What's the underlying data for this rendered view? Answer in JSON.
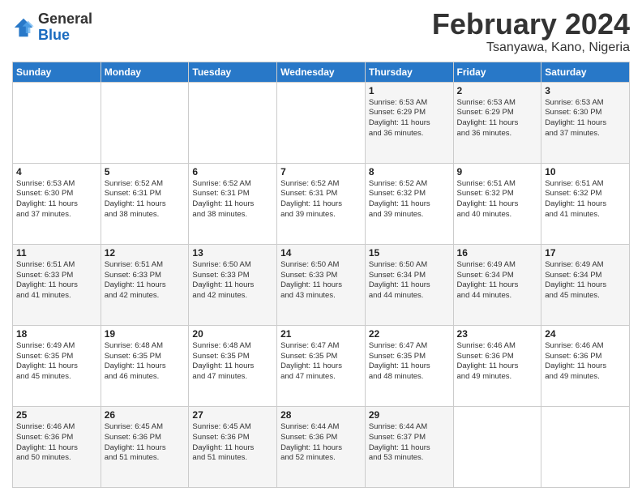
{
  "header": {
    "logo_line1": "General",
    "logo_line2": "Blue",
    "month": "February 2024",
    "location": "Tsanyawa, Kano, Nigeria"
  },
  "weekdays": [
    "Sunday",
    "Monday",
    "Tuesday",
    "Wednesday",
    "Thursday",
    "Friday",
    "Saturday"
  ],
  "weeks": [
    [
      {
        "day": "",
        "info": ""
      },
      {
        "day": "",
        "info": ""
      },
      {
        "day": "",
        "info": ""
      },
      {
        "day": "",
        "info": ""
      },
      {
        "day": "1",
        "info": "Sunrise: 6:53 AM\nSunset: 6:29 PM\nDaylight: 11 hours\nand 36 minutes."
      },
      {
        "day": "2",
        "info": "Sunrise: 6:53 AM\nSunset: 6:29 PM\nDaylight: 11 hours\nand 36 minutes."
      },
      {
        "day": "3",
        "info": "Sunrise: 6:53 AM\nSunset: 6:30 PM\nDaylight: 11 hours\nand 37 minutes."
      }
    ],
    [
      {
        "day": "4",
        "info": "Sunrise: 6:53 AM\nSunset: 6:30 PM\nDaylight: 11 hours\nand 37 minutes."
      },
      {
        "day": "5",
        "info": "Sunrise: 6:52 AM\nSunset: 6:31 PM\nDaylight: 11 hours\nand 38 minutes."
      },
      {
        "day": "6",
        "info": "Sunrise: 6:52 AM\nSunset: 6:31 PM\nDaylight: 11 hours\nand 38 minutes."
      },
      {
        "day": "7",
        "info": "Sunrise: 6:52 AM\nSunset: 6:31 PM\nDaylight: 11 hours\nand 39 minutes."
      },
      {
        "day": "8",
        "info": "Sunrise: 6:52 AM\nSunset: 6:32 PM\nDaylight: 11 hours\nand 39 minutes."
      },
      {
        "day": "9",
        "info": "Sunrise: 6:51 AM\nSunset: 6:32 PM\nDaylight: 11 hours\nand 40 minutes."
      },
      {
        "day": "10",
        "info": "Sunrise: 6:51 AM\nSunset: 6:32 PM\nDaylight: 11 hours\nand 41 minutes."
      }
    ],
    [
      {
        "day": "11",
        "info": "Sunrise: 6:51 AM\nSunset: 6:33 PM\nDaylight: 11 hours\nand 41 minutes."
      },
      {
        "day": "12",
        "info": "Sunrise: 6:51 AM\nSunset: 6:33 PM\nDaylight: 11 hours\nand 42 minutes."
      },
      {
        "day": "13",
        "info": "Sunrise: 6:50 AM\nSunset: 6:33 PM\nDaylight: 11 hours\nand 42 minutes."
      },
      {
        "day": "14",
        "info": "Sunrise: 6:50 AM\nSunset: 6:33 PM\nDaylight: 11 hours\nand 43 minutes."
      },
      {
        "day": "15",
        "info": "Sunrise: 6:50 AM\nSunset: 6:34 PM\nDaylight: 11 hours\nand 44 minutes."
      },
      {
        "day": "16",
        "info": "Sunrise: 6:49 AM\nSunset: 6:34 PM\nDaylight: 11 hours\nand 44 minutes."
      },
      {
        "day": "17",
        "info": "Sunrise: 6:49 AM\nSunset: 6:34 PM\nDaylight: 11 hours\nand 45 minutes."
      }
    ],
    [
      {
        "day": "18",
        "info": "Sunrise: 6:49 AM\nSunset: 6:35 PM\nDaylight: 11 hours\nand 45 minutes."
      },
      {
        "day": "19",
        "info": "Sunrise: 6:48 AM\nSunset: 6:35 PM\nDaylight: 11 hours\nand 46 minutes."
      },
      {
        "day": "20",
        "info": "Sunrise: 6:48 AM\nSunset: 6:35 PM\nDaylight: 11 hours\nand 47 minutes."
      },
      {
        "day": "21",
        "info": "Sunrise: 6:47 AM\nSunset: 6:35 PM\nDaylight: 11 hours\nand 47 minutes."
      },
      {
        "day": "22",
        "info": "Sunrise: 6:47 AM\nSunset: 6:35 PM\nDaylight: 11 hours\nand 48 minutes."
      },
      {
        "day": "23",
        "info": "Sunrise: 6:46 AM\nSunset: 6:36 PM\nDaylight: 11 hours\nand 49 minutes."
      },
      {
        "day": "24",
        "info": "Sunrise: 6:46 AM\nSunset: 6:36 PM\nDaylight: 11 hours\nand 49 minutes."
      }
    ],
    [
      {
        "day": "25",
        "info": "Sunrise: 6:46 AM\nSunset: 6:36 PM\nDaylight: 11 hours\nand 50 minutes."
      },
      {
        "day": "26",
        "info": "Sunrise: 6:45 AM\nSunset: 6:36 PM\nDaylight: 11 hours\nand 51 minutes."
      },
      {
        "day": "27",
        "info": "Sunrise: 6:45 AM\nSunset: 6:36 PM\nDaylight: 11 hours\nand 51 minutes."
      },
      {
        "day": "28",
        "info": "Sunrise: 6:44 AM\nSunset: 6:36 PM\nDaylight: 11 hours\nand 52 minutes."
      },
      {
        "day": "29",
        "info": "Sunrise: 6:44 AM\nSunset: 6:37 PM\nDaylight: 11 hours\nand 53 minutes."
      },
      {
        "day": "",
        "info": ""
      },
      {
        "day": "",
        "info": ""
      }
    ]
  ]
}
